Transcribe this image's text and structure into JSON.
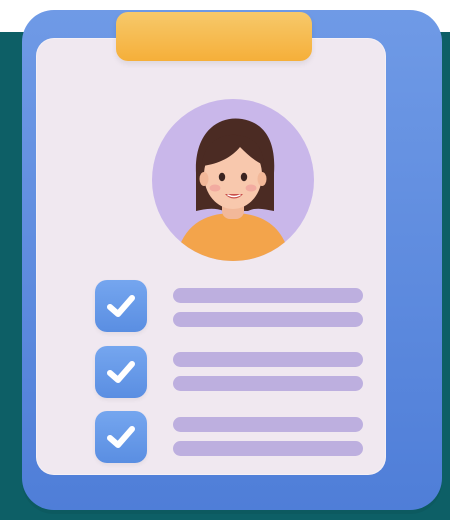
{
  "scene": {
    "description_name": "clipboard-profile-checklist",
    "checklist": {
      "items": [
        {
          "checked": true
        },
        {
          "checked": true
        },
        {
          "checked": true
        }
      ]
    },
    "colors": {
      "background": "#0d5f66",
      "board": "#5a89df",
      "paper": "#f0e8f0",
      "clip": "#f5af3a",
      "avatar_bg": "#c9b7ea",
      "check_bg": "#5a8ee2",
      "text_line": "#bdafdf"
    },
    "icons": [
      "clipboard-icon",
      "avatar-icon",
      "checkmark-icon"
    ]
  }
}
